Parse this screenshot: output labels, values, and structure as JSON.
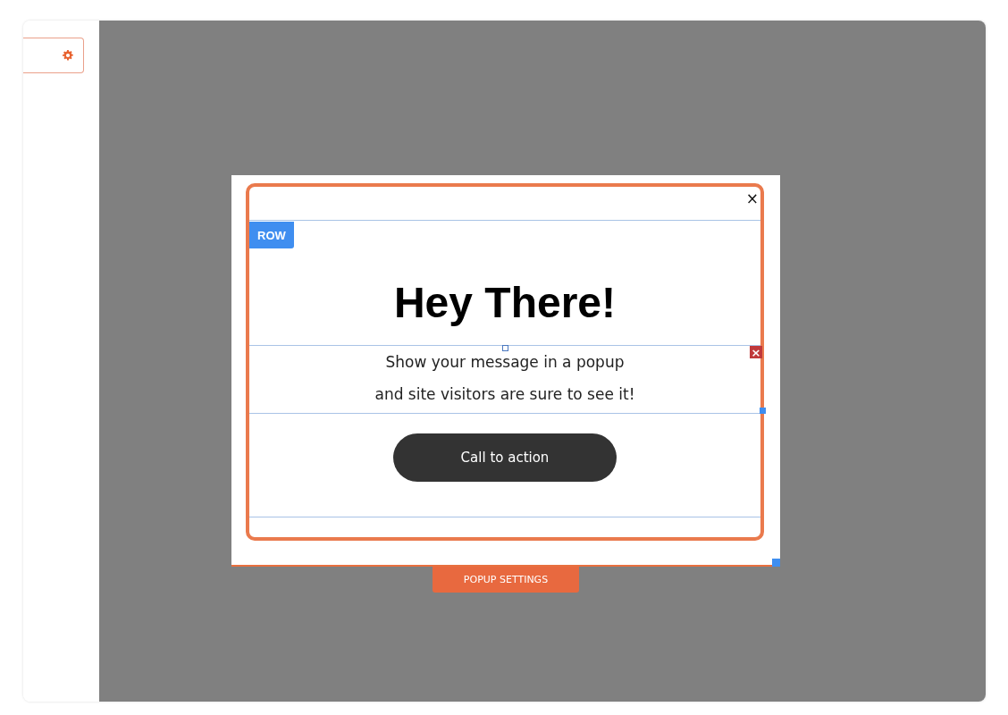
{
  "popup": {
    "close": "×",
    "row_label": "ROW",
    "heading": "Hey There!",
    "message": [
      "Show your message in a popup",
      "and site visitors are sure to see it!"
    ],
    "button": "Call to action",
    "delete": "×"
  },
  "settings_button": "POPUP SETTINGS"
}
